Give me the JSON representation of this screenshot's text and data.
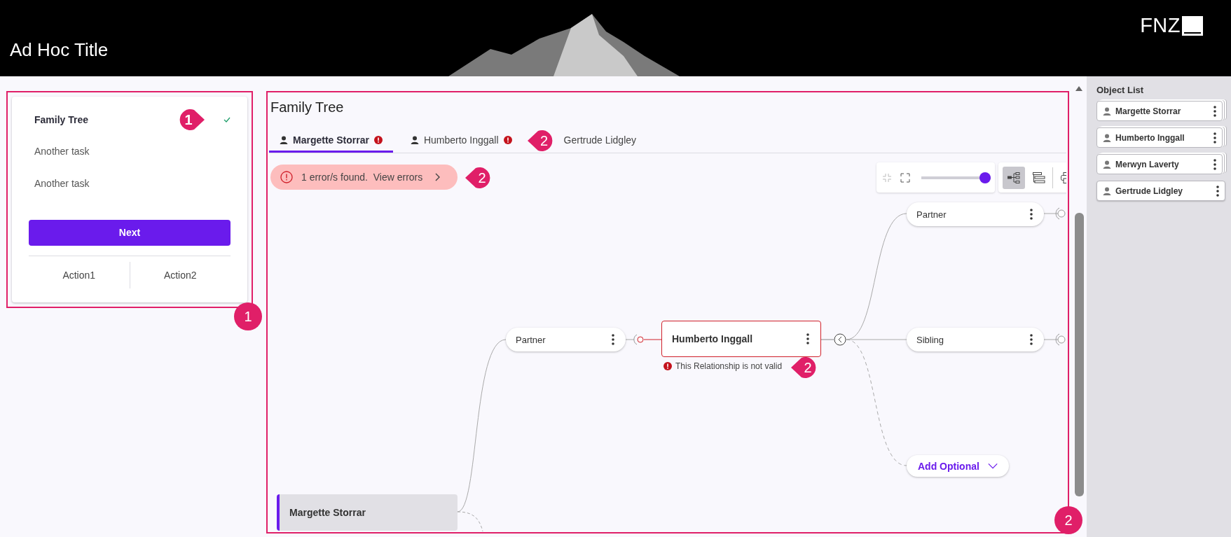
{
  "header": {
    "title": "Ad Hoc Title",
    "logo": "FNZ"
  },
  "left_panel": {
    "annotation": {
      "label": "1",
      "kind": "circle"
    },
    "tasks": [
      {
        "label": "Family Tree",
        "selected": true,
        "done": true,
        "annotation": {
          "label": "1",
          "kind": "pin-right"
        }
      },
      {
        "label": "Another task",
        "selected": false,
        "done": false
      },
      {
        "label": "Another task",
        "selected": false,
        "done": false
      }
    ],
    "next_button": "Next",
    "actions": [
      "Action1",
      "Action2"
    ]
  },
  "main": {
    "title": "Family Tree",
    "annotation": {
      "label": "2",
      "kind": "circle"
    },
    "tabs": [
      {
        "label": "Margette Storrar",
        "selected": true,
        "error": true
      },
      {
        "label": "Humberto Inggall",
        "selected": false,
        "error": true,
        "annotation": {
          "label": "2",
          "kind": "pin-left"
        }
      },
      {
        "label": "Gertrude Lidgley",
        "selected": false,
        "error": false
      }
    ],
    "error_banner": {
      "text": "1 error/s found.  View errors",
      "annotation": {
        "label": "2",
        "kind": "pin-left"
      }
    },
    "toolbar": {
      "zoom": {
        "level": 1.0
      },
      "views": [
        {
          "kind": "tree",
          "selected": true
        },
        {
          "kind": "list",
          "selected": false
        }
      ]
    },
    "tree": {
      "nodes": [
        {
          "kind": "person",
          "name": "Margette Storrar",
          "selected": true
        },
        {
          "kind": "relation",
          "label": "Partner"
        },
        {
          "kind": "person",
          "name": "Humberto Inggall",
          "selected": false,
          "error": "This Relationship is not valid",
          "annotation": {
            "label": "2",
            "kind": "pin-left"
          }
        },
        {
          "kind": "relation",
          "label": "Partner"
        },
        {
          "kind": "relation",
          "label": "Sibling"
        },
        {
          "kind": "add",
          "label": "Add Optional"
        }
      ]
    }
  },
  "object_list": {
    "title": "Object List",
    "items": [
      {
        "name": "Margette Storrar",
        "stacked": true
      },
      {
        "name": "Humberto Inggall",
        "stacked": true
      },
      {
        "name": "Merwyn Laverty",
        "stacked": true
      },
      {
        "name": "Gertrude Lidgley",
        "stacked": false
      }
    ]
  }
}
